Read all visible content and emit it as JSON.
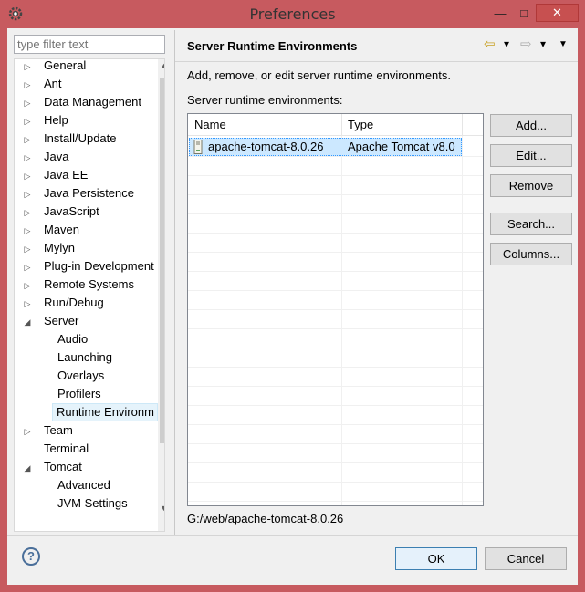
{
  "window": {
    "title": "Preferences",
    "min_label": "—",
    "max_label": "□",
    "close_label": "✕"
  },
  "filter": {
    "placeholder": "type filter text"
  },
  "tree": {
    "items": [
      {
        "label": "General",
        "expander": "▷"
      },
      {
        "label": "Ant",
        "expander": "▷"
      },
      {
        "label": "Data Management",
        "expander": "▷"
      },
      {
        "label": "Help",
        "expander": "▷"
      },
      {
        "label": "Install/Update",
        "expander": "▷"
      },
      {
        "label": "Java",
        "expander": "▷"
      },
      {
        "label": "Java EE",
        "expander": "▷"
      },
      {
        "label": "Java Persistence",
        "expander": "▷"
      },
      {
        "label": "JavaScript",
        "expander": "▷"
      },
      {
        "label": "Maven",
        "expander": "▷"
      },
      {
        "label": "Mylyn",
        "expander": "▷"
      },
      {
        "label": "Plug-in Development",
        "expander": "▷"
      },
      {
        "label": "Remote Systems",
        "expander": "▷"
      },
      {
        "label": "Run/Debug",
        "expander": "▷"
      },
      {
        "label": "Server",
        "expander": "◢"
      },
      {
        "label": "Audio",
        "expander": ""
      },
      {
        "label": "Launching",
        "expander": ""
      },
      {
        "label": "Overlays",
        "expander": ""
      },
      {
        "label": "Profilers",
        "expander": ""
      },
      {
        "label": "Runtime Environm",
        "expander": ""
      },
      {
        "label": "Team",
        "expander": "▷"
      },
      {
        "label": "Terminal",
        "expander": ""
      },
      {
        "label": "Tomcat",
        "expander": "◢"
      },
      {
        "label": "Advanced",
        "expander": ""
      },
      {
        "label": "JVM Settings",
        "expander": ""
      }
    ]
  },
  "page": {
    "title": "Server Runtime Environments",
    "description": "Add, remove, or edit server runtime environments.",
    "list_label": "Server runtime environments:",
    "columns": [
      "Name",
      "Type"
    ],
    "rows": [
      {
        "name": "apache-tomcat-8.0.26",
        "type": "Apache Tomcat v8.0"
      }
    ],
    "path": "G:/web/apache-tomcat-8.0.26",
    "nav": {
      "back": "⇦",
      "back_menu": "▾",
      "forward": "⇨",
      "forward_menu": "▾",
      "view_menu": "▼"
    }
  },
  "buttons": {
    "add": "Add...",
    "edit": "Edit...",
    "remove": "Remove",
    "search": "Search...",
    "columns": "Columns...",
    "ok": "OK",
    "cancel": "Cancel",
    "help": "?"
  },
  "colors": {
    "frame": "#c75a5f",
    "selection": "#cce8ff",
    "tree_selection": "#e5f3fb"
  }
}
